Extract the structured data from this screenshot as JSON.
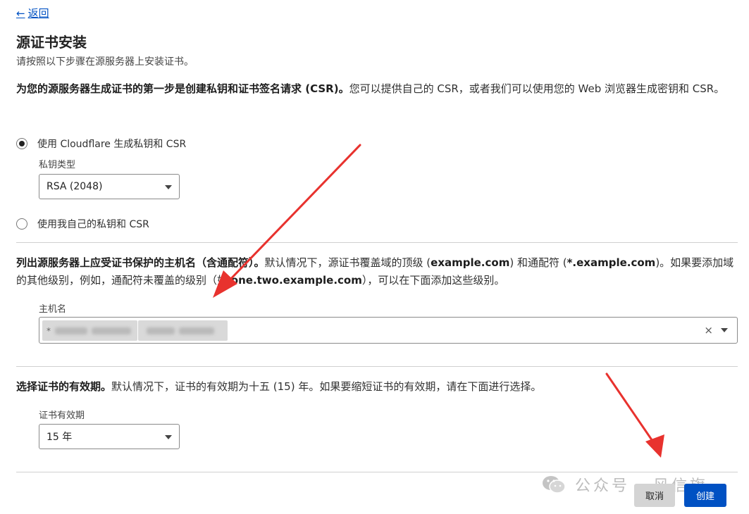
{
  "nav": {
    "back_arrow": "←",
    "back_label": "返回"
  },
  "header": {
    "title": "源证书安装",
    "subtitle": "请按照以下步骤在源服务器上安装证书。"
  },
  "section_keys": {
    "bold": "为您的源服务器生成证书的第一步是创建私钥和证书签名请求 (CSR)。",
    "text": "您可以提供自己的 CSR，或者我们可以使用您的 Web 浏览器生成密钥和 CSR。",
    "options": [
      {
        "label": "使用 Cloudflare 生成私钥和 CSR",
        "selected": true
      },
      {
        "label": "使用我自己的私钥和 CSR",
        "selected": false
      }
    ],
    "key_type_label": "私钥类型",
    "key_type_value": "RSA (2048)"
  },
  "section_hosts": {
    "bold": "列出源服务器上应受证书保护的主机名（含通配符）。",
    "text_1": "默认情况下，源证书覆盖域的顶级 (",
    "example_1": "example.com",
    "text_2": ") 和通配符 (",
    "example_2": "*.example.com",
    "text_3": ")。如果要添加域的其他级别，例如，通配符未覆盖的级别（如 ",
    "example_3": "one.two.example.com",
    "text_4": "），可以在下面添加这些级别。",
    "hostname_label": "主机名",
    "chips": [
      {
        "prefix": "*"
      },
      {
        "prefix": ""
      }
    ],
    "clear_symbol": "×"
  },
  "section_validity": {
    "bold": "选择证书的有效期。",
    "text": "默认情况下，证书的有效期为十五 (15) 年。如果要缩短证书的有效期，请在下面进行选择。",
    "validity_label": "证书有效期",
    "validity_value": "15 年"
  },
  "footer": {
    "cancel_label": "取消",
    "create_label": "创建",
    "watermark": "公众号 · 风信旗"
  },
  "colors": {
    "accent": "#0051c3",
    "annotation_arrow": "#e8322e",
    "divider": "#d0d0d0"
  }
}
